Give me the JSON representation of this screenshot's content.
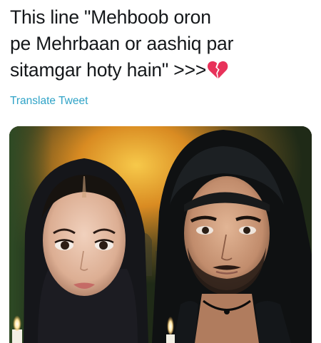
{
  "tweet": {
    "lines": [
      "This line \"Mehboob oron",
      "pe Mehrbaan or aashiq par",
      "sitamgar hoty hain\" >>>"
    ],
    "emoji": "broken-heart-icon",
    "translate_label": "Translate Tweet"
  },
  "media": {
    "kind": "photo",
    "subject": "poster-image"
  },
  "colors": {
    "text": "#14171a",
    "link": "#2fa3c7",
    "heart": "#e8325a"
  }
}
